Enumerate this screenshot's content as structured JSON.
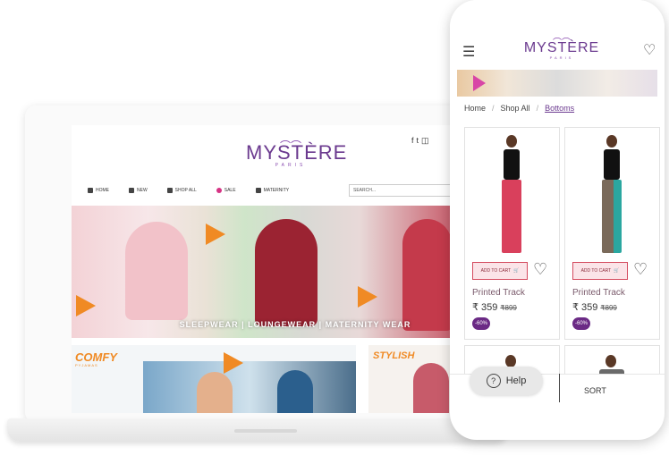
{
  "desktop": {
    "brand": {
      "name": "MYSTÈRE",
      "sub": "PARIS"
    },
    "social_icons": [
      "facebook-icon",
      "twitter-icon",
      "instagram-icon"
    ],
    "nav": [
      {
        "label": "HOME",
        "icon": "home-icon"
      },
      {
        "label": "NEW",
        "icon": "new-icon"
      },
      {
        "label": "SHOP ALL",
        "icon": "grid-icon"
      },
      {
        "label": "SALE",
        "icon": "sale-icon"
      },
      {
        "label": "MATERNITY",
        "icon": "maternity-icon"
      }
    ],
    "search": {
      "placeholder": "SEARCH..."
    },
    "hero_caption": "SLEEPWEAR | LOUNGEWEAR | MATERNITY WEAR",
    "card1": {
      "title": "COMFY",
      "subtitle": "PYJAMAS"
    },
    "card2": {
      "title": "STYLISH"
    }
  },
  "mobile": {
    "brand": {
      "name": "MYSTÈRE",
      "sub": "PARIS"
    },
    "breadcrumb": [
      {
        "label": "Home"
      },
      {
        "label": "Shop All"
      },
      {
        "label": "Bottoms"
      }
    ],
    "products": [
      {
        "add_to_cart": "ADD TO CART",
        "name": "Printed Track",
        "price": "₹ 359",
        "mrp": "₹899",
        "discount": "-60%",
        "pants_color": "#d9405c"
      },
      {
        "add_to_cart": "ADD TO CART",
        "name": "Printed Track",
        "price": "₹ 359",
        "mrp": "₹899",
        "discount": "-60%",
        "pants_color": "#7a6a5a"
      }
    ],
    "help_label": "Help",
    "sort_label": "SORT"
  },
  "colors": {
    "brand": "#6b3a8f",
    "accent": "#f08a24",
    "discount": "#6b2a85"
  }
}
